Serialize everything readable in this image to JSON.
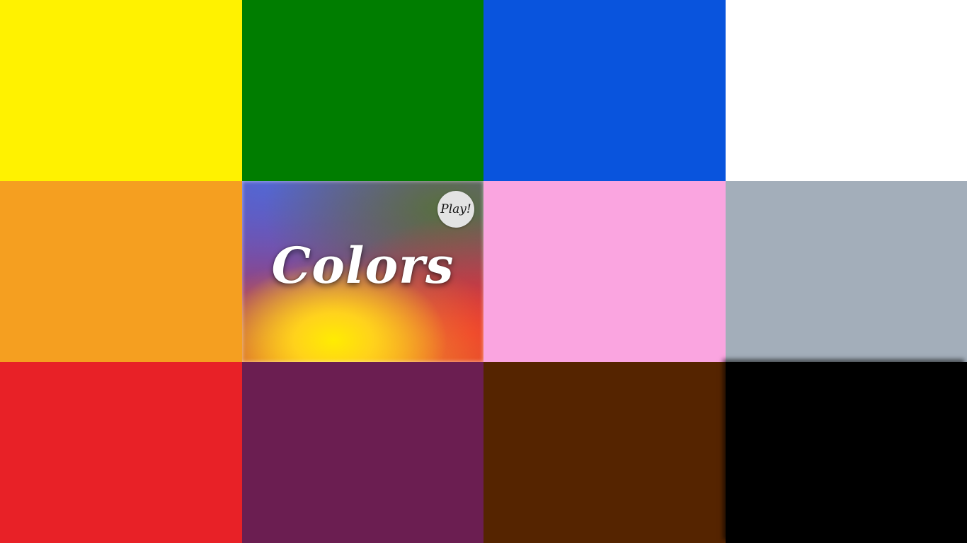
{
  "game": {
    "title": "Colors",
    "play_label": "Play!"
  },
  "tiles": [
    {
      "name": "yellow",
      "color": "#fff200"
    },
    {
      "name": "green",
      "color": "#007d00"
    },
    {
      "name": "blue",
      "color": "#0954dd"
    },
    {
      "name": "white",
      "color": "#ffffff"
    },
    {
      "name": "orange",
      "color": "#f59f20"
    },
    {
      "name": "title",
      "color": null
    },
    {
      "name": "pink",
      "color": "#faa5e0"
    },
    {
      "name": "gray",
      "color": "#a3aeba"
    },
    {
      "name": "red",
      "color": "#e82127"
    },
    {
      "name": "purple",
      "color": "#6b1e51"
    },
    {
      "name": "brown",
      "color": "#552400"
    },
    {
      "name": "black",
      "color": "#000000"
    }
  ]
}
